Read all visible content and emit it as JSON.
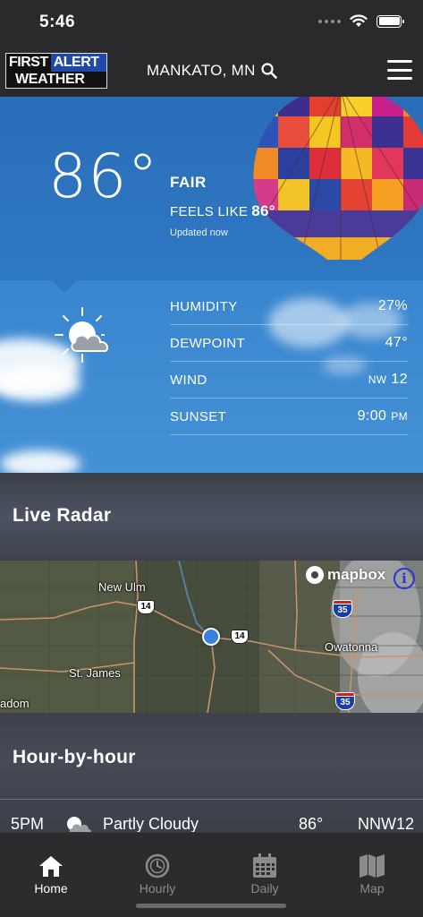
{
  "status_bar": {
    "time": "5:46"
  },
  "header": {
    "logo_line1a": "FIRST",
    "logo_line1b": "ALERT",
    "logo_line2": "WEATHER",
    "location": "MANKATO, MN"
  },
  "current": {
    "temperature": "86°",
    "condition": "FAIR",
    "feels_like_label": "FEELS LIKE",
    "feels_like_value": "86°",
    "updated": "Updated now",
    "icon": "partly-cloudy-icon",
    "stats": [
      {
        "label": "HUMIDITY",
        "value": "27%"
      },
      {
        "label": "DEWPOINT",
        "value": "47°"
      },
      {
        "label": "WIND",
        "dir": "NW",
        "value": "12"
      },
      {
        "label": "SUNSET",
        "value": "9:00",
        "unit": "PM"
      }
    ]
  },
  "radar": {
    "title": "Live Radar",
    "attribution": "mapbox",
    "towns": [
      "New Ulm",
      "St. James",
      "Owatonna",
      "adom"
    ],
    "route_us": "14",
    "route_interstate": "35"
  },
  "hourly": {
    "title": "Hour-by-hour",
    "rows": [
      {
        "time": "5PM",
        "condition": "Partly Cloudy",
        "temp": "86°",
        "wind": "NNW12"
      }
    ]
  },
  "tabs": [
    {
      "label": "Home",
      "icon": "home-icon",
      "active": true
    },
    {
      "label": "Hourly",
      "icon": "clock-icon",
      "active": false
    },
    {
      "label": "Daily",
      "icon": "calendar-icon",
      "active": false
    },
    {
      "label": "Map",
      "icon": "map-icon",
      "active": false
    }
  ],
  "colors": {
    "accent_blue": "#2f78c3",
    "tab_inactive": "#8b8b8e",
    "location_dot": "#3b7fe0"
  }
}
